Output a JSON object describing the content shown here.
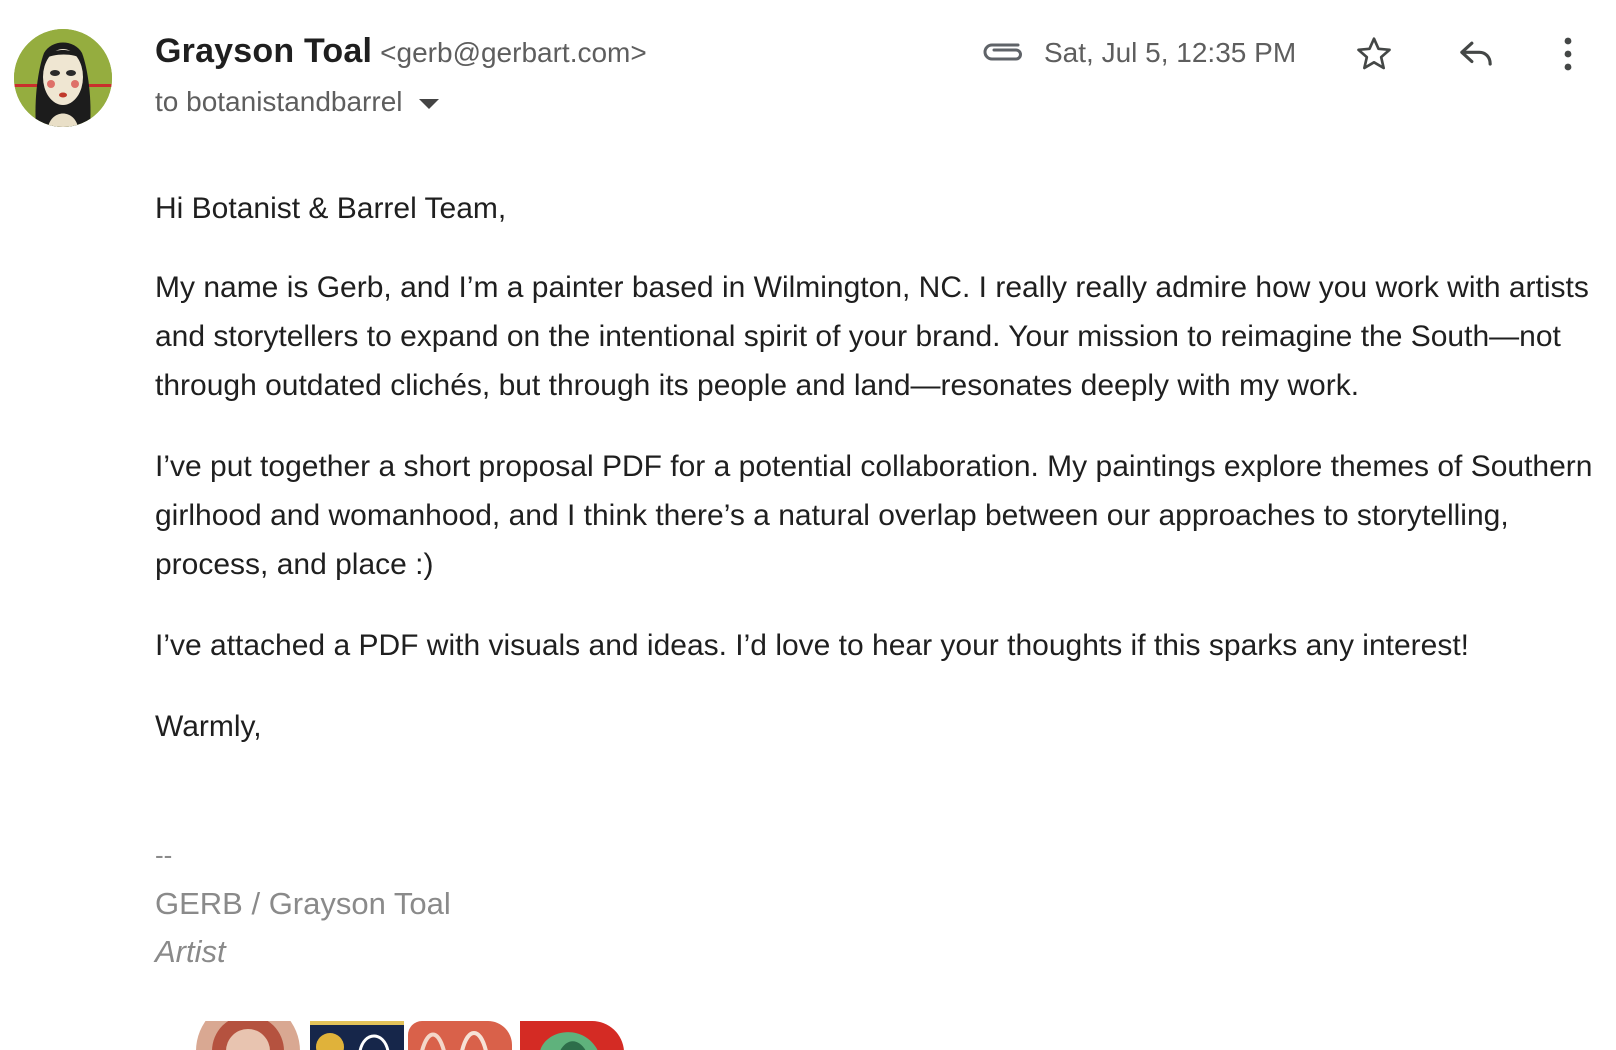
{
  "sender": {
    "name": "Grayson Toal",
    "email": "<gerb@gerbart.com>"
  },
  "recipients": "to botanistandbarrel",
  "timestamp": "Sat, Jul 5, 12:35 PM",
  "icons": {
    "attachment": "paperclip-icon",
    "star": "star-outline-icon",
    "reply": "reply-icon",
    "more": "more-vert-icon",
    "expand": "caret-down-icon"
  },
  "body": {
    "greeting": "Hi Botanist & Barrel Team,",
    "paragraphs": [
      "My name is Gerb, and I’m a painter based in Wilmington, NC. I really really admire how you work with artists and storytellers to expand on the intentional spirit of your brand. Your mission to reimagine the South—not through outdated clichés, but through its people and land—resonates deeply with my work.",
      "I’ve put together a short proposal PDF for a potential collaboration. My paintings explore themes of Southern girlhood and womanhood, and I think there’s a natural overlap between our approaches to storytelling, process, and place :)",
      "I’ve attached a PDF with visuals and ideas. I’d love to hear your thoughts if this sparks any interest!"
    ],
    "closing": "Warmly,"
  },
  "signature": {
    "separator": "--",
    "name": "GERB / Grayson Toal",
    "title": "Artist"
  }
}
